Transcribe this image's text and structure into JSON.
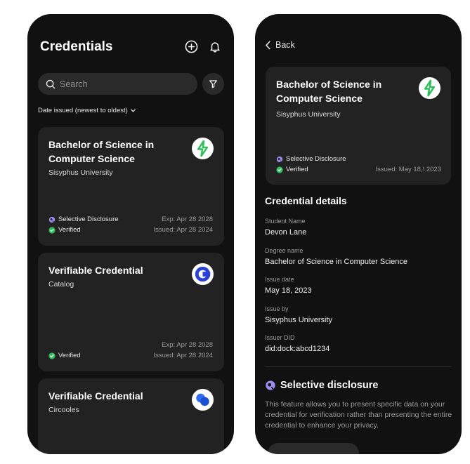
{
  "list_screen": {
    "title": "Credentials",
    "search": {
      "placeholder": "Search",
      "value": ""
    },
    "sort_label": "Date issued (newest to oldest)",
    "cards": [
      {
        "title": "Bachelor of Science in Computer Science",
        "issuer": "Sisyphus University",
        "logo": "bolt-logo-icon",
        "badges": [
          "Selective Disclosure",
          "Verified"
        ],
        "exp": "Exp: Apr 28 2028",
        "issued": "Issued: Apr 28 2024"
      },
      {
        "title": "Verifiable Credential",
        "issuer": "Catalog",
        "logo": "c-logo-icon",
        "badges": [
          "Verified"
        ],
        "exp": "Exp: Apr 28 2028",
        "issued": "Issued: Apr 28 2024"
      },
      {
        "title": "Verifiable Credential",
        "issuer": "Circooles",
        "logo": "circles-logo-icon",
        "badges": [],
        "exp": "",
        "issued": ""
      }
    ]
  },
  "detail_screen": {
    "back_label": "Back",
    "card": {
      "title": "Bachelor of Science in Computer Science",
      "issuer": "Sisyphus University",
      "badge_sd": "Selective Disclosure",
      "badge_verified": "Verified",
      "issued": "Issued: May 18,\\ 2023"
    },
    "details_title": "Credential details",
    "fields": [
      {
        "label": "Student Name",
        "value": "Devon Lane"
      },
      {
        "label": "Degree name",
        "value": "Bachelor of Science in Computer Science"
      },
      {
        "label": "Issue date",
        "value": "May 18, 2023"
      },
      {
        "label": "Issue by",
        "value": "Sisyphus University"
      },
      {
        "label": "Issuer DID",
        "value": "did:dock:abcd1234"
      }
    ],
    "sd_title": "Selective disclosure",
    "sd_description": "This feature allows you to present specific data on your credential for verification rather than presenting the entire credential to enhance your privacy."
  },
  "colors": {
    "background": "#111111",
    "card": "#222222",
    "verified_green": "#2fbf5a",
    "sd_purple": "#9b8cf0",
    "muted_text": "#9a9a9a"
  }
}
